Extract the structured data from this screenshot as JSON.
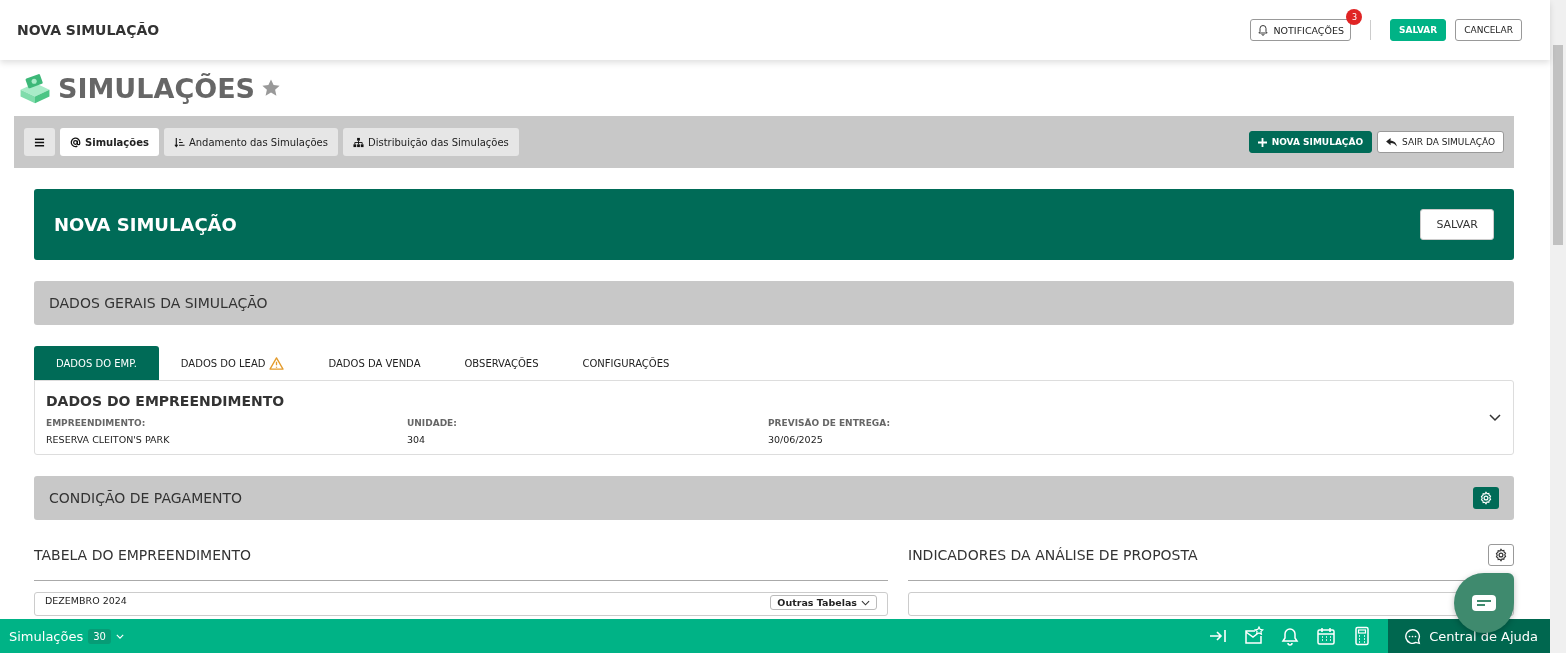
{
  "header": {
    "title": "NOVA SIMULAÇÃO",
    "notifications": {
      "label": "NOTIFICAÇÕES",
      "count": "3"
    },
    "buttons": [
      {
        "label": "SALVAR",
        "kind": "primary"
      },
      {
        "label": "CANCELAR",
        "kind": "outline"
      }
    ]
  },
  "page": {
    "title": "SIMULAÇÕES",
    "favorite": false
  },
  "toolbar": {
    "tabs": [
      {
        "label": "Simulações",
        "kind": "at",
        "selected": true
      },
      {
        "label": "Andamento das Simulações",
        "kind": "sort",
        "selected": false
      },
      {
        "label": "Distribuição das Simulações",
        "kind": "tree",
        "selected": false
      }
    ],
    "actions": [
      {
        "label": "NOVA SIMULAÇÃO",
        "kind": "primary"
      },
      {
        "label": "SAIR DA SIMULAÇÃO",
        "kind": "outline"
      }
    ]
  },
  "banner": {
    "title": "NOVA SIMULAÇÃO",
    "button": "SALVAR"
  },
  "general_section": {
    "title": "DADOS GERAIS DA SIMULAÇÃO"
  },
  "tabs": [
    {
      "label": "DADOS DO EMP.",
      "selected": true,
      "warning": false
    },
    {
      "label": "DADOS DO LEAD",
      "selected": false,
      "warning": true
    },
    {
      "label": "DADOS DA VENDA",
      "selected": false,
      "warning": false
    },
    {
      "label": "OBSERVAÇÕES",
      "selected": false,
      "warning": false
    },
    {
      "label": "CONFIGURAÇÕES",
      "selected": false,
      "warning": false
    }
  ],
  "details": {
    "title": "DADOS DO EMPREENDIMENTO",
    "expanded": false,
    "fields": [
      {
        "label": "EMPREENDIMENTO:",
        "value": "RESERVA CLEITON'S PARK"
      },
      {
        "label": "UNIDADE:",
        "value": "304"
      },
      {
        "label": "PREVISÃO DE ENTREGA:",
        "value": "30/06/2025"
      }
    ]
  },
  "payment_section": {
    "title": "CONDIÇÃO DE PAGAMENTO"
  },
  "table_panel": {
    "title": "TABELA DO EMPREENDIMENTO",
    "card_title": "DEZEMBRO 2024",
    "dropdown": "Outras Tabelas"
  },
  "indicators_panel": {
    "title": "INDICADORES DA ANÁLISE DE PROPOSTA"
  },
  "bottom_bar": {
    "label": "Simulações",
    "count": "30",
    "help": "Central de Ajuda"
  }
}
